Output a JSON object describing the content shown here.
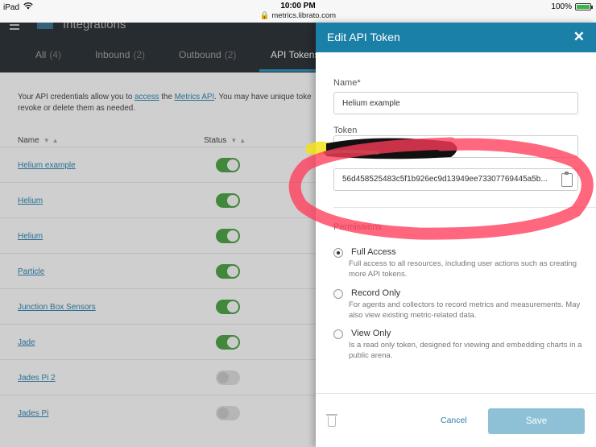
{
  "status_bar": {
    "device": "iPad",
    "time": "10:00 PM",
    "url": "metrics.librato.com",
    "battery": "100%",
    "battery_level": 1.0
  },
  "app": {
    "title": "Integrations",
    "tabs": [
      {
        "label": "All",
        "count": "(4)"
      },
      {
        "label": "Inbound",
        "count": "(2)"
      },
      {
        "label": "Outbound",
        "count": "(2)"
      },
      {
        "label": "API Tokens",
        "count": ""
      }
    ],
    "intro": {
      "text1": "Your API credentials allow you to ",
      "link1": "access",
      "text2": " the ",
      "link2": "Metrics API",
      "text3": ". You may have unique toke",
      "line2": "revoke or delete them as needed."
    },
    "columns": {
      "name": "Name",
      "status": "Status"
    },
    "rows": [
      {
        "name": "Helium example",
        "enabled": true
      },
      {
        "name": "Helium",
        "enabled": true
      },
      {
        "name": "Helium",
        "enabled": true
      },
      {
        "name": "Particle",
        "enabled": true
      },
      {
        "name": "Junction Box Sensors",
        "enabled": true
      },
      {
        "name": "Jade",
        "enabled": true
      },
      {
        "name": "Jades Pi 2",
        "enabled": false
      },
      {
        "name": "Jades Pi",
        "enabled": false
      }
    ]
  },
  "panel": {
    "title": "Edit API Token",
    "close_icon": "close-icon",
    "name_label": "Name*",
    "name_value": "Helium example",
    "token_label": "Token",
    "token_value": "56d458525483c5f1b926ec9d13949ee73307769445a5b...",
    "permissions_label": "Permissions",
    "options": [
      {
        "title": "Full Access",
        "desc": "Full access to all resources, including user actions such as creating more API tokens.",
        "checked": true
      },
      {
        "title": "Record Only",
        "desc": "For agents and collectors to record metrics and measurements. May also view existing metric-related data.",
        "checked": false
      },
      {
        "title": "View Only",
        "desc": "Is a read only token, designed for viewing and embedding charts in a public arena.",
        "checked": false
      }
    ],
    "cancel_label": "Cancel",
    "save_label": "Save"
  },
  "colors": {
    "accent": "#1b80a8",
    "toggle_on": "#4a9a45",
    "annotation_red": "#ff3c5a",
    "highlighter": "#f5e21a"
  }
}
